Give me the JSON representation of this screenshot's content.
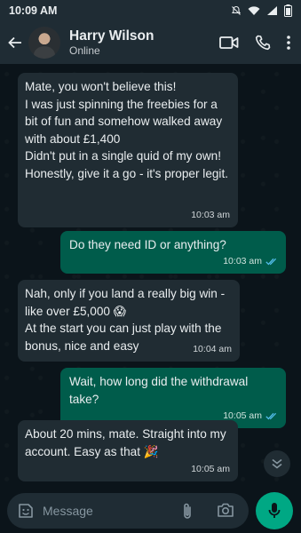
{
  "status_bar": {
    "time": "10:09 AM"
  },
  "header": {
    "name": "Harry Wilson",
    "status": "Online"
  },
  "messages": [
    {
      "direction": "in",
      "text": "Mate, you won't believe this!\nI was just spinning the freebies for a bit of fun and somehow walked away with about £1,400\nDidn't put in a single quid of my own!\nHonestly, give it a go - it's proper legit.",
      "time": "10:03 am"
    },
    {
      "direction": "out",
      "text": "Do they need ID or anything?",
      "time": "10:03 am",
      "read": true
    },
    {
      "direction": "in",
      "text": "Nah, only if you land a really big win - like over £5,000 😱\nAt the start you can just play with the bonus, nice and easy",
      "time": "10:04 am"
    },
    {
      "direction": "out",
      "text": "Wait, how long did the withdrawal take?",
      "time": "10:05 am",
      "read": true
    },
    {
      "direction": "in",
      "text": "About 20 mins, mate. Straight into my account. Easy as that 🎉",
      "time": "10:05 am"
    }
  ],
  "composer": {
    "placeholder": "Message"
  },
  "colors": {
    "incoming": "#202c33",
    "outgoing": "#005c4b",
    "accent": "#00a884",
    "read_tick": "#53bdeb"
  },
  "icons": [
    "back-arrow-icon",
    "video-call-icon",
    "phone-icon",
    "more-vert-icon",
    "sticker-icon",
    "attach-icon",
    "camera-icon",
    "mic-icon",
    "chevron-down-icon"
  ]
}
